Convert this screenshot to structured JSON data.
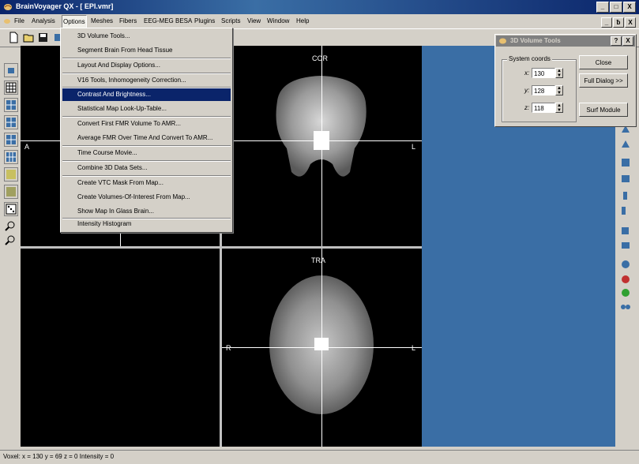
{
  "window": {
    "title": "BrainVoyager QX - [ EPI.vmr]",
    "controls": [
      "_",
      "□",
      "X"
    ],
    "mdi_controls": [
      "_",
      "ƀ",
      "X"
    ]
  },
  "menubar": {
    "items": [
      "File",
      "Analysis",
      "Options",
      "Meshes",
      "Fibers",
      "EEG-MEG BESA",
      "Plugins",
      "Scripts",
      "View",
      "Window",
      "Help"
    ],
    "active": "Options"
  },
  "options_menu": {
    "items": [
      {
        "label": "3D Volume Tools..."
      },
      {
        "label": "Segment Brain From Head Tissue"
      },
      {
        "label": "Layout And Display Options..."
      },
      {
        "label": "V16 Tools, Inhomogeneity Correction..."
      },
      {
        "label": "Contrast And Brightness...",
        "highlighted": true
      },
      {
        "label": "Statistical Map Look-Up-Table..."
      },
      {
        "label": "Convert First FMR Volume To AMR..."
      },
      {
        "label": "Average FMR Over Time And Convert To AMR..."
      },
      {
        "label": "Time Course Movie..."
      },
      {
        "label": "Combine 3D Data Sets..."
      },
      {
        "label": "Create VTC Mask From Map..."
      },
      {
        "label": "Create Volumes-Of-Interest From Map..."
      },
      {
        "label": "Show Map In Glass Brain..."
      },
      {
        "label": "Intensity Histogram"
      }
    ]
  },
  "views": {
    "coronal": {
      "label": "COR",
      "left": "A",
      "right": "L"
    },
    "transverse": {
      "label": "TRA",
      "left": "R",
      "right": "L"
    }
  },
  "volume_tools": {
    "title": "3D Volume Tools",
    "title_buttons": [
      "?",
      "X"
    ],
    "group_label": "System coords",
    "coords": [
      {
        "axis": "x:",
        "value": "130"
      },
      {
        "axis": "y:",
        "value": "128"
      },
      {
        "axis": "z:",
        "value": "118"
      }
    ],
    "buttons": {
      "close": "Close",
      "full_dialog": "Full Dialog >>",
      "surf_module": "Surf Module"
    }
  },
  "statusbar": {
    "text": "Voxel:  x = 130  y = 69  z = 0  Intensity = 0"
  },
  "colors": {
    "titlebar": "#0a246a",
    "workspace": "#3a6ea5",
    "menu_highlight": "#0a246a"
  }
}
